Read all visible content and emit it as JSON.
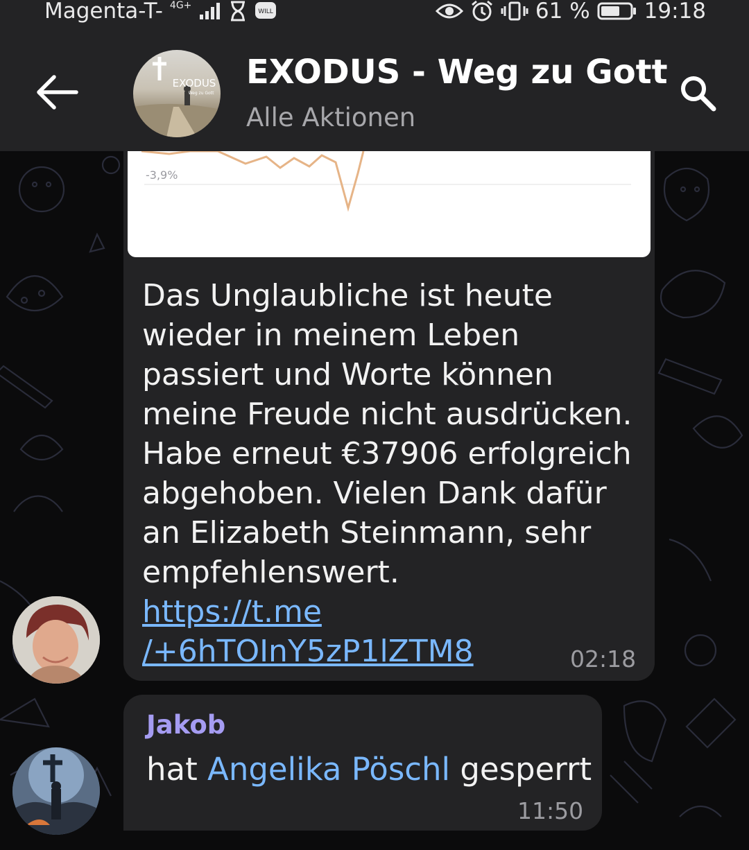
{
  "status_bar": {
    "carrier": "Magenta-T-",
    "network": "4G+",
    "battery": "61 %",
    "time": "19:18"
  },
  "header": {
    "title": "EXODUS - Weg zu Gott",
    "subtitle": "Alle Aktionen",
    "avatar_text": "EXODUS",
    "avatar_subtext": "Weg zu Gott"
  },
  "messages": [
    {
      "chart_tick": "-3,9%",
      "text": "Das Unglaubliche ist heute wieder in meinem Leben passiert und Worte können meine Freude nicht ausdrücken. Habe erneut €37906 erfolgreich abgehoben.  Vielen Dank dafür an Elizabeth Steinmann, sehr empfehlenswert.",
      "link_line1": "https://t.me",
      "link_line2": "/+6hTOInY5zP1lZTM8",
      "time": "02:18"
    },
    {
      "sender": "Jakob",
      "prefix": "hat ",
      "mention": "Angelika Pöschl",
      "suffix": " gesperrt",
      "time": "11:50"
    }
  ],
  "colors": {
    "background": "#0b0b0c",
    "bar": "#232325",
    "bubble": "#232325",
    "link": "#7ab8ff",
    "sender_name": "#a59cf2",
    "timestamp": "#9c9ca1"
  }
}
